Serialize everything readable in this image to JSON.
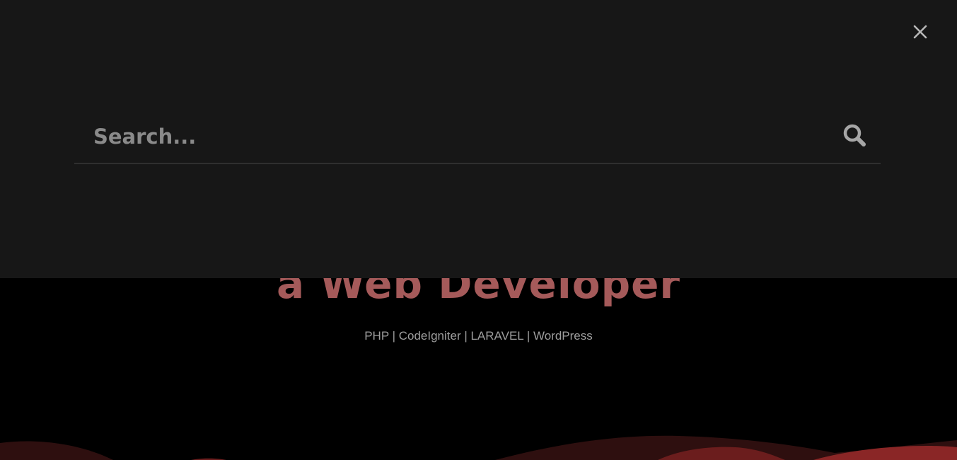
{
  "hero": {
    "heading": "a Web Developer",
    "subtitle": "PHP | CodeIgniter | LARAVEL | WordPress"
  },
  "search_overlay": {
    "placeholder": "Search...",
    "value": "",
    "close_icon": "close-icon",
    "search_icon": "search-icon"
  },
  "colors": {
    "overlay_bg": "#171717",
    "page_bg": "#000000",
    "heading": "#a55a5a",
    "wave_dark": "#3a1212",
    "wave_mid": "#5c1a1a",
    "wave_bright": "#8a2626"
  }
}
